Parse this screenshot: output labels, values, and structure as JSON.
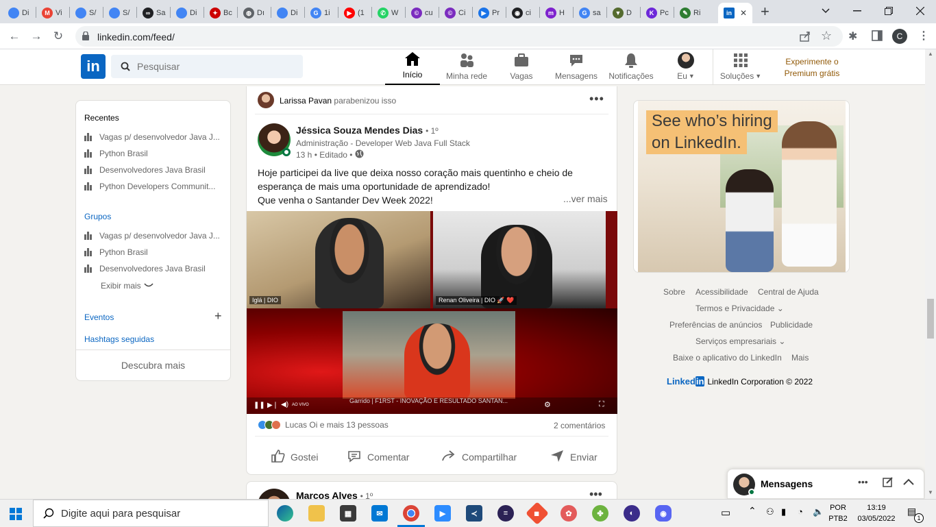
{
  "browser": {
    "tabs": [
      {
        "label": "Di",
        "color": "#4285f4",
        "glyph": ""
      },
      {
        "label": "Vi",
        "color": "#ea4335",
        "glyph": "M"
      },
      {
        "label": "S/",
        "color": "#4285f4",
        "glyph": ""
      },
      {
        "label": "S/",
        "color": "#4285f4",
        "glyph": ""
      },
      {
        "label": "Sa",
        "color": "#202124",
        "glyph": "∞"
      },
      {
        "label": "Di",
        "color": "#4285f4",
        "glyph": ""
      },
      {
        "label": "Bc",
        "color": "#cc0000",
        "glyph": "✦"
      },
      {
        "label": "Dı",
        "color": "#5f6368",
        "glyph": "◍"
      },
      {
        "label": "Di",
        "color": "#4285f4",
        "glyph": ""
      },
      {
        "label": "1i",
        "color": "#4285f4",
        "glyph": "G"
      },
      {
        "label": "(1",
        "color": "#ff0000",
        "glyph": "▶"
      },
      {
        "label": "W",
        "color": "#25d366",
        "glyph": "✆"
      },
      {
        "label": "cu",
        "color": "#7b2cbf",
        "glyph": "©"
      },
      {
        "label": "Ci",
        "color": "#7b2cbf",
        "glyph": "©"
      },
      {
        "label": "Pr",
        "color": "#1a73e8",
        "glyph": "▶"
      },
      {
        "label": "ci",
        "color": "#202124",
        "glyph": "◉"
      },
      {
        "label": "H",
        "color": "#7e22ce",
        "glyph": "m"
      },
      {
        "label": "sa",
        "color": "#4285f4",
        "glyph": "G"
      },
      {
        "label": "D",
        "color": "#556b2f",
        "glyph": "▼"
      },
      {
        "label": "Pc",
        "color": "#6d28d9",
        "glyph": "K"
      },
      {
        "label": "Ri",
        "color": "#2e7d32",
        "glyph": "✎"
      }
    ],
    "active_tab_close": "✕",
    "new_tab": "+",
    "url": "linkedin.com/feed/"
  },
  "linkedin": {
    "search_placeholder": "Pesquisar",
    "nav": [
      {
        "label": "Início",
        "icon": "home-icon"
      },
      {
        "label": "Minha rede",
        "icon": "network-icon"
      },
      {
        "label": "Vagas",
        "icon": "jobs-icon"
      },
      {
        "label": "Mensagens",
        "icon": "messaging-icon"
      },
      {
        "label": "Notificações",
        "icon": "bell-icon"
      },
      {
        "label": "Eu",
        "icon": "avatar"
      },
      {
        "label": "Soluções",
        "icon": "grid-icon"
      }
    ],
    "premium": {
      "line1": "Experimente o",
      "line2": "Premium grátis"
    }
  },
  "left": {
    "recent_title": "Recentes",
    "recent": [
      "Vagas p/ desenvolvedor Java J...",
      "Python Brasil",
      "Desenvolvedores Java Brasil",
      "Python Developers Communit..."
    ],
    "groups_title": "Grupos",
    "groups": [
      "Vagas p/ desenvolvedor Java J...",
      "Python Brasil",
      "Desenvolvedores Java Brasil"
    ],
    "show_more": "Exibir mais",
    "events": "Eventos",
    "events_add": "+",
    "hashtags": "Hashtags seguidas",
    "discover": "Descubra mais"
  },
  "post": {
    "context_name": "Larissa Pavan",
    "context_action": "parabenizou isso",
    "author": "Jéssica Souza Mendes Dias",
    "degree": "• 1º",
    "headline": "Administração - Developer Web Java Full Stack",
    "time": "13 h • Editado •",
    "text_lines": [
      "Hoje participei da live que deixa nosso coração mais quentinho e cheio de",
      "esperança de mais uma oportunidade de aprendizado!",
      "Que venha o Santander Dev Week 2022!"
    ],
    "see_more": "...ver mais",
    "video": {
      "tile1": "Iglá | DIO",
      "tile2": "Renan Oliveira | DIO 🚀 ❤️",
      "banner": "Garrido | F1RST - INOVAÇÃO E RESULTADO SANTAN...",
      "live": "AO VIVO"
    },
    "reactions": "Lucas Oi e mais 13 pessoas",
    "comments": "2 comentários",
    "actions": [
      {
        "label": "Gostei",
        "icon": "like-icon"
      },
      {
        "label": "Comentar",
        "icon": "comment-icon"
      },
      {
        "label": "Compartilhar",
        "icon": "share-icon"
      },
      {
        "label": "Enviar",
        "icon": "send-icon"
      }
    ]
  },
  "next_post": {
    "author": "Marcos Alves",
    "degree": "• 1º"
  },
  "ad": {
    "line1": "See who’s hiring",
    "line2": "on LinkedIn."
  },
  "footer": {
    "row1": [
      "Sobre",
      "Acessibilidade",
      "Central de Ajuda"
    ],
    "row2": [
      "Termos e Privacidade"
    ],
    "row3": [
      "Preferências de anúncios",
      "Publicidade"
    ],
    "row4": [
      "Serviços empresariais"
    ],
    "row5": [
      "Baixe o aplicativo do LinkedIn",
      "Mais"
    ],
    "brand": "Linked",
    "brand_in": "in",
    "copyright": "LinkedIn Corporation © 2022"
  },
  "messaging": {
    "title": "Mensagens"
  },
  "taskbar": {
    "search_placeholder": "Digite aqui para pesquisar",
    "lang1": "POR",
    "lang2": "PTB2",
    "time": "13:19",
    "date": "03/05/2022",
    "notif_count": "1"
  }
}
